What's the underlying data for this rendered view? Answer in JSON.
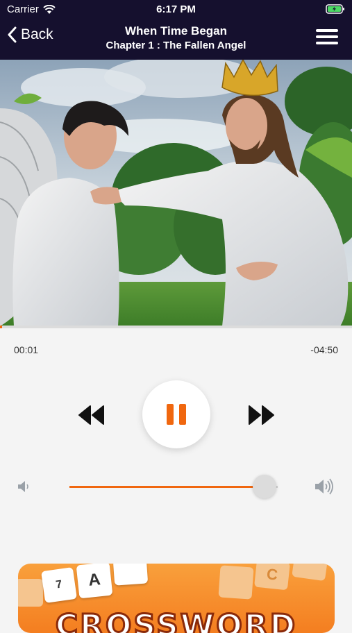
{
  "status_bar": {
    "carrier": "Carrier",
    "time": "6:17 PM"
  },
  "nav": {
    "back_label": "Back",
    "title": "When Time Began",
    "subtitle": "Chapter 1 : The Fallen Angel"
  },
  "player": {
    "elapsed": "00:01",
    "remaining": "-04:50",
    "progress_fraction": 0.005,
    "volume_fraction": 0.94,
    "state": "playing"
  },
  "banner": {
    "word": "CROSSWORD",
    "tiles": [
      "7",
      "A",
      "C"
    ]
  },
  "colors": {
    "accent": "#f0670f",
    "navbar": "#15102e"
  },
  "icons": [
    "wifi-icon",
    "battery-icon",
    "back-chevron-icon",
    "menu-icon",
    "rewind-icon",
    "pause-icon",
    "fast-forward-icon",
    "volume-low-icon",
    "volume-high-icon"
  ]
}
